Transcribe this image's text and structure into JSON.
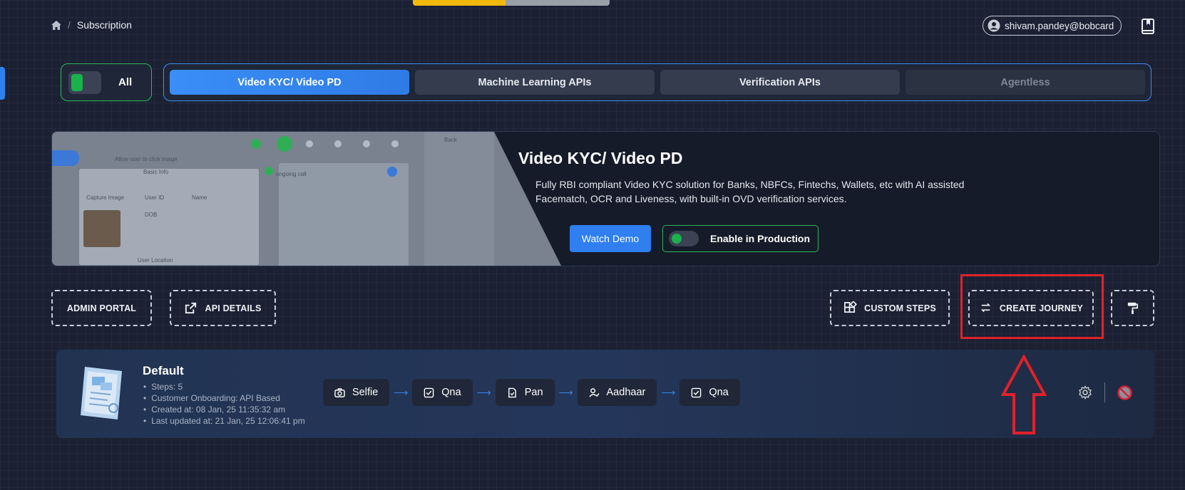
{
  "breadcrumb": {
    "current": "Subscription"
  },
  "top_progress": {
    "fraction": 0.47
  },
  "user": {
    "email": "shivam.pandey@bobcard"
  },
  "filter": {
    "all_label": "All"
  },
  "tabs": [
    {
      "label": "Video KYC/ Video PD",
      "state": "active"
    },
    {
      "label": "Machine Learning APIs",
      "state": "normal"
    },
    {
      "label": "Verification APIs",
      "state": "normal"
    },
    {
      "label": "Agentless",
      "state": "disabled"
    }
  ],
  "hero": {
    "title": "Video KYC/ Video PD",
    "description": "Fully RBI compliant Video KYC solution for Banks, NBFCs, Fintechs, Wallets, etc with AI assisted Facematch, OCR and Liveness, with built-in OVD verification services.",
    "watch_demo_label": "Watch Demo",
    "enable_production_label": "Enable in Production",
    "preview": {
      "allow_user": "Allow user to click image",
      "basic_info": "Basic Info",
      "capture_image": "Capture Image",
      "user_id": "User ID",
      "name": "Name",
      "dob": "DOB",
      "user_location": "User Location",
      "ongoing_call": "ongoing call",
      "back": "Back"
    }
  },
  "actions": {
    "admin_portal": "ADMIN PORTAL",
    "api_details": "API DETAILS",
    "custom_steps": "CUSTOM STEPS",
    "create_journey": "CREATE JOURNEY"
  },
  "journey": {
    "title": "Default",
    "meta": [
      "Steps: 5",
      "Customer Onboarding: API Based",
      "Created at: 08 Jan, 25 11:35:32 am",
      "Last updated at: 21 Jan, 25 12:06:41 pm"
    ],
    "steps": [
      {
        "label": "Selfie",
        "icon": "camera-icon"
      },
      {
        "label": "Qna",
        "icon": "checkbox-icon"
      },
      {
        "label": "Pan",
        "icon": "document-check-icon"
      },
      {
        "label": "Aadhaar",
        "icon": "user-check-icon"
      },
      {
        "label": "Qna",
        "icon": "checkbox-icon"
      }
    ],
    "arrow": "⟶"
  },
  "colors": {
    "accent": "#2f7ff0",
    "success": "#19b24b",
    "highlight": "#e0212b",
    "warning": "#f0b90b"
  }
}
